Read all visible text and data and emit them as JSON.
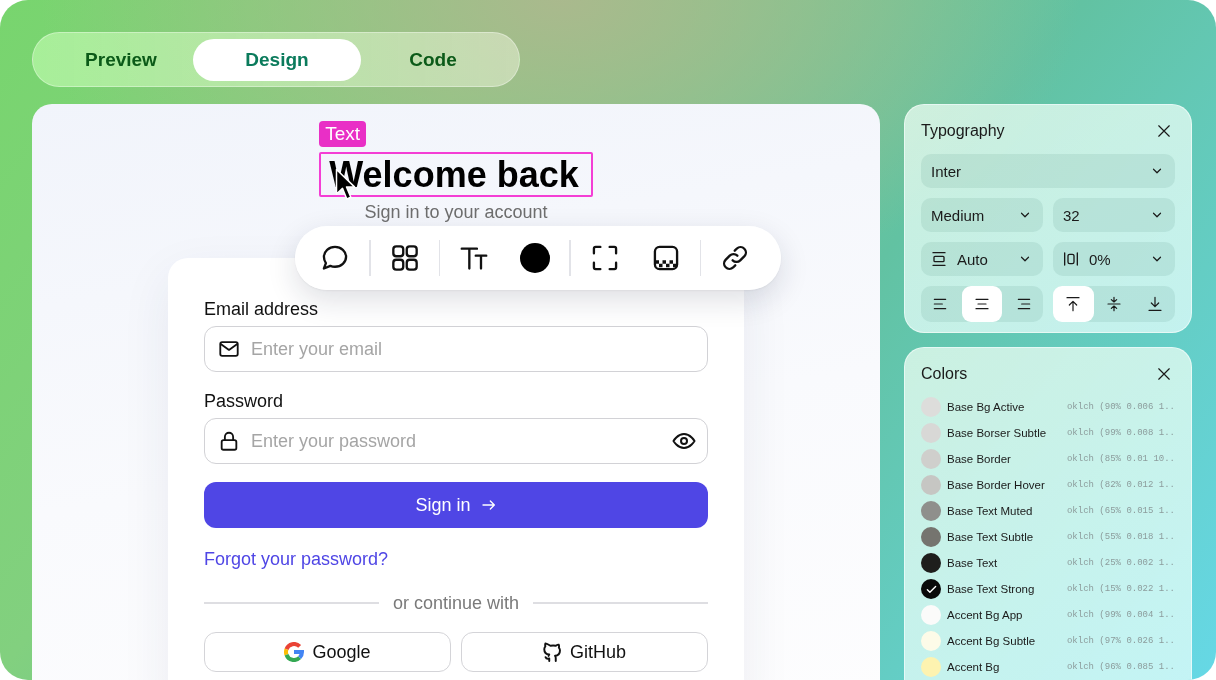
{
  "tabs": [
    {
      "label": "Preview",
      "selected": false
    },
    {
      "label": "Design",
      "selected": true
    },
    {
      "label": "Code",
      "selected": false
    }
  ],
  "canvas": {
    "selection_label": "Text",
    "heading": "Welcome back",
    "subheading": "Sign in to your account",
    "form": {
      "fields": [
        {
          "kind": "email",
          "label": "Email address",
          "placeholder": "Enter your email"
        },
        {
          "kind": "password",
          "label": "Password",
          "placeholder": "Enter your password"
        }
      ],
      "submit_button": "Sign in",
      "forgot_link": "Forgot your password?",
      "divider": "or continue with",
      "providers": [
        {
          "kind": "google",
          "label": "Google"
        },
        {
          "kind": "github",
          "label": "GitHub"
        }
      ]
    }
  },
  "toolbar": {
    "groups": [
      {
        "tools": [
          {
            "kind": "comment"
          }
        ]
      },
      {
        "tools": [
          {
            "kind": "components"
          }
        ]
      },
      {
        "tools": [
          {
            "kind": "text_style"
          },
          {
            "kind": "color",
            "color": "#000000"
          }
        ]
      },
      {
        "tools": [
          {
            "kind": "frame"
          },
          {
            "kind": "fill"
          }
        ]
      },
      {
        "tools": [
          {
            "kind": "link"
          }
        ]
      }
    ]
  },
  "typography_panel": {
    "title": "Typography",
    "font_family": "Inter",
    "font_weight": "Medium",
    "font_size": "32",
    "line_height": "Auto",
    "letter_spacing": "0%",
    "text_align": [
      {
        "kind": "left",
        "selected": false
      },
      {
        "kind": "center",
        "selected": true
      },
      {
        "kind": "right",
        "selected": false
      }
    ],
    "vertical_align": [
      {
        "kind": "top",
        "selected": true
      },
      {
        "kind": "middle",
        "selected": false
      },
      {
        "kind": "bottom",
        "selected": false
      }
    ]
  },
  "colors_panel": {
    "title": "Colors",
    "items": [
      {
        "name": "Base Bg Active",
        "value": "oklch (90% 0.006 1..",
        "color": "#dddddb",
        "selected": false
      },
      {
        "name": "Base Borser Subtle",
        "value": "oklch (99% 0.008 1..",
        "color": "#d8d8d6",
        "selected": false
      },
      {
        "name": "Base Border",
        "value": "oklch (85% 0.01 10..",
        "color": "#cfcfcc",
        "selected": false
      },
      {
        "name": "Base Border Hover",
        "value": "oklch (82% 0.012 1..",
        "color": "#c6c6c3",
        "selected": false
      },
      {
        "name": "Base Text Muted",
        "value": "oklch (65% 0.015 1..",
        "color": "#8f8f8c",
        "selected": false
      },
      {
        "name": "Base Text Subtle",
        "value": "oklch (55% 0.018 1..",
        "color": "#75746f",
        "selected": false
      },
      {
        "name": "Base Text",
        "value": "oklch (25% 0.002 1..",
        "color": "#1e1e1c",
        "selected": false
      },
      {
        "name": "Base Text Strong",
        "value": "oklch (15% 0.022 1..",
        "color": "#0a0a0a",
        "selected": true
      },
      {
        "name": "Accent Bg App",
        "value": "oklch (99% 0.004 1..",
        "color": "#fbfbfa",
        "selected": false
      },
      {
        "name": "Accent Bg Subtle",
        "value": "oklch (97% 0.026 1..",
        "color": "#fdfbe8",
        "selected": false
      },
      {
        "name": "Accent Bg",
        "value": "oklch (96% 0.085 1..",
        "color": "#fdf3b0",
        "selected": false
      }
    ]
  }
}
